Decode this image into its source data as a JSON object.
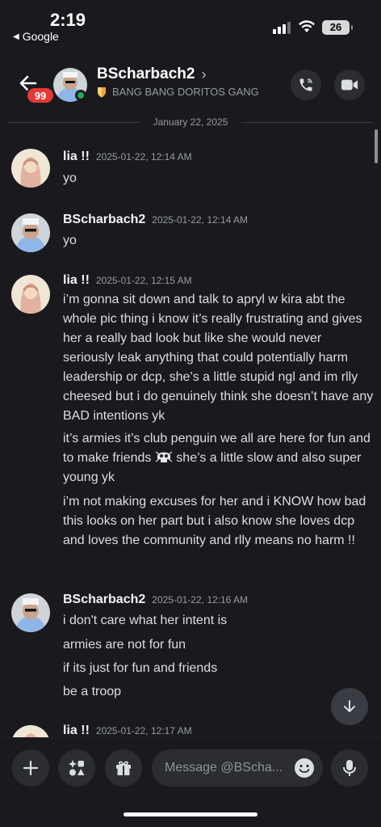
{
  "status_bar": {
    "time": "2:19",
    "back_app": "Google",
    "battery": "26"
  },
  "header": {
    "badge": "99",
    "name": "BScharbach2",
    "chevron": "›",
    "server_tag": "BANG BANG DORITOS GANG",
    "call_icon": "phone-icon",
    "video_icon": "video-icon"
  },
  "date_divider": "January 22, 2025",
  "messages": [
    {
      "user": "lia !!",
      "timestamp": "2025-01-22, 12:14 AM",
      "lines": [
        "yo"
      ]
    },
    {
      "user": "BScharbach2",
      "timestamp": "2025-01-22, 12:14 AM",
      "lines": [
        "yo"
      ]
    },
    {
      "user": "lia !!",
      "timestamp": "2025-01-22, 12:15 AM",
      "p1": "i’m gonna sit down and talk to apryl w kira abt the whole pic thing i know it’s really frustrating and gives her a really bad look but like she would never seriously leak anything that could potentially harm leadership or dcp, she’s a  little stupid ngl and im rlly cheesed but i do genuinely think she doesn’t have any BAD intentions yk",
      "p2a": "it’s armies it’s club penguin we all are here for fun and to make friends",
      "p2b": " she’s a little slow and also super young yk",
      "p3": "i’m not making excuses for her and i KNOW how bad this looks on her part but i also know she loves dcp and loves the community and rlly means no harm !!"
    },
    {
      "user": "BScharbach2",
      "timestamp": "2025-01-22, 12:16 AM",
      "lines": [
        "i don't care what her intent is",
        "armies are not for fun",
        "if its just for fun and friends",
        "be a troop"
      ]
    },
    {
      "user": "lia !!",
      "timestamp": "2025-01-22, 12:17 AM"
    }
  ],
  "composer": {
    "placeholder": "Message @BScha...",
    "add_icon": "plus-icon",
    "apps_icon": "apps-icon",
    "gift_icon": "gift-icon",
    "emoji_icon": "smiley-icon",
    "mic_icon": "microphone-icon"
  },
  "jump_icon": "arrow-down-icon"
}
